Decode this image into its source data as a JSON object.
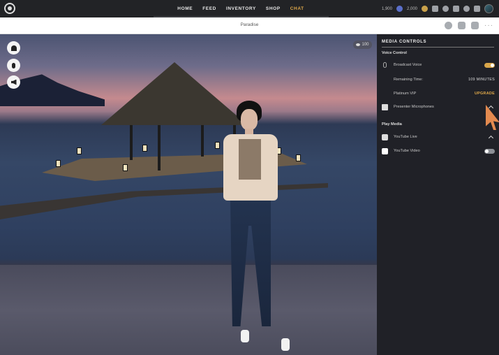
{
  "nav": {
    "items": [
      "HOME",
      "FEED",
      "INVENTORY",
      "SHOP",
      "CHAT"
    ],
    "active": "CHAT"
  },
  "currency": {
    "vip_credits": "1,900",
    "coins": "2,000"
  },
  "room": {
    "title": "Paradise"
  },
  "scene": {
    "viewer_count": "100"
  },
  "media_panel": {
    "title": "MEDIA CONTROLS",
    "voice_control": {
      "heading": "Voice Control",
      "broadcast_voice_label": "Broadcast Voice",
      "broadcast_voice_on": true,
      "remaining_time_label": "Remaining Time:",
      "remaining_time_value": "109 MINUTES",
      "platinum_vip_label": "Platinum VIP",
      "upgrade_label": "UPGRADE",
      "presenter_mics_label": "Presenter Microphones"
    },
    "play_media": {
      "heading": "Play Media",
      "youtube_live_label": "YouTube Live",
      "youtube_video_label": "YouTube Video",
      "youtube_video_on": false
    }
  },
  "colors": {
    "accent": "#e0a94a",
    "topbar": "#222326",
    "panel": "#23252c",
    "cursor": "#e38a4f"
  },
  "icons": [
    "logo-icon",
    "vip-coin-icon",
    "credit-coin-icon",
    "cart-icon",
    "notification-icon",
    "home-icon",
    "chat-icon",
    "profile-icon",
    "avatar",
    "chat-bubble-icon",
    "outfit-icon",
    "camera-icon",
    "more-icon",
    "person-icon",
    "microphone-icon",
    "speaker-icon",
    "eye-icon",
    "presenter-icon",
    "youtube-live-icon",
    "youtube-video-icon"
  ]
}
